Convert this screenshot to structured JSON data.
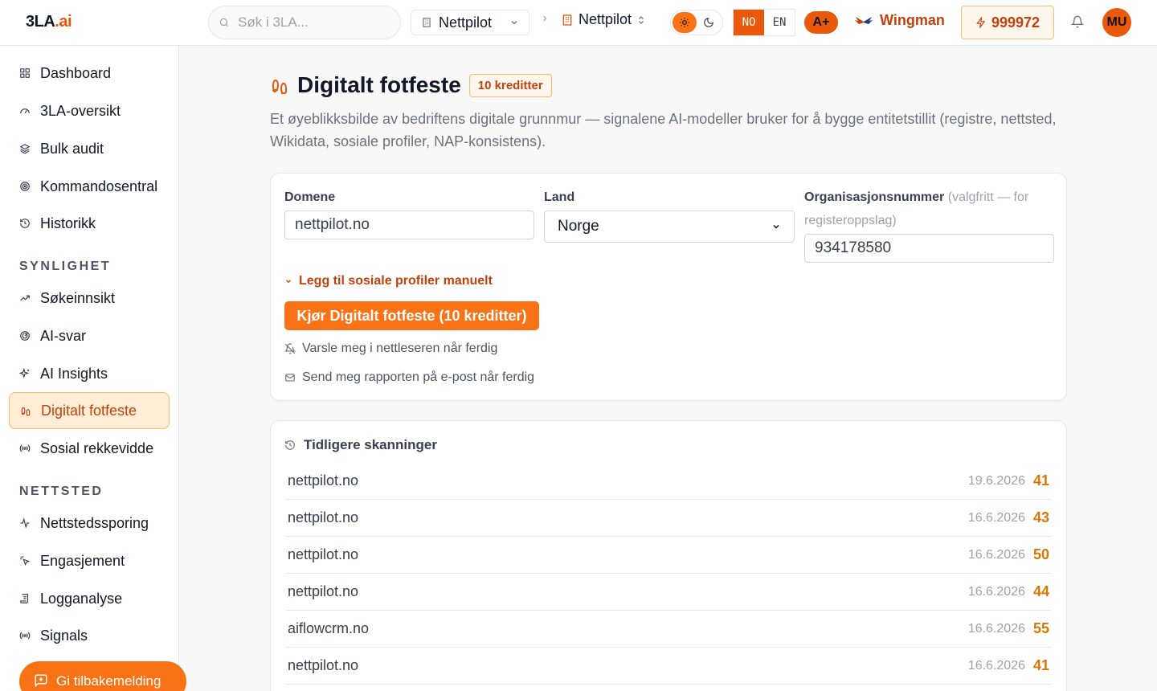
{
  "app": {
    "logo_main": "3LA",
    "logo_suffix": ".ai",
    "search_placeholder": "Søk i 3LA...",
    "workspace": "Nettpilot",
    "project": "Nettpilot",
    "lang_active": "NO",
    "lang_other": "EN",
    "grade": "A+",
    "wingman": "Wingman",
    "credits": "999972",
    "avatar_initials": "MU",
    "accent_color": "#f97316"
  },
  "sidebar": {
    "items_top": [
      {
        "label": "Dashboard",
        "icon": "grid-icon"
      },
      {
        "label": "3LA-oversikt",
        "icon": "gauge-icon"
      },
      {
        "label": "Bulk audit",
        "icon": "layers-icon"
      },
      {
        "label": "Kommandosentral",
        "icon": "target-icon"
      },
      {
        "label": "Historikk",
        "icon": "history-icon"
      }
    ],
    "section_synlighet": "SYNLIGHET",
    "items_synlighet": [
      {
        "label": "Søkeinnsikt",
        "icon": "trend-icon"
      },
      {
        "label": "AI-svar",
        "icon": "radar-icon"
      },
      {
        "label": "AI Insights",
        "icon": "sparkles-icon"
      },
      {
        "label": "Digitalt fotfeste",
        "icon": "footprints-icon",
        "active": true
      },
      {
        "label": "Sosial rekkevidde",
        "icon": "broadcast-icon"
      }
    ],
    "section_nettsted": "NETTSTED",
    "items_nettsted": [
      {
        "label": "Nettstedssporing",
        "icon": "activity-icon"
      },
      {
        "label": "Engasjement",
        "icon": "pointer-icon"
      },
      {
        "label": "Logganalyse",
        "icon": "scroll-icon"
      },
      {
        "label": "Signals",
        "icon": "broadcast-icon"
      }
    ],
    "feedback_label": "Gi tilbakemelding"
  },
  "main": {
    "title": "Digitalt fotfeste",
    "badge": "10 kreditter",
    "subtitle": "Et øyeblikksbilde av bedriftens digitale grunnmur — signalene AI-modeller bruker for å bygge entitetstillit (registre, nettsted, Wikidata, sosiale profiler, NAP-konsistens).",
    "form": {
      "domain_label": "Domene",
      "domain_value": "nettpilot.no",
      "country_label": "Land",
      "country_value": "Norge",
      "org_label": "Organisasjonsnummer",
      "org_hint": "(valgfritt — for registeroppslag)",
      "org_value": "934178580",
      "social_toggle": "Legg til sosiale profiler manuelt",
      "run_button": "Kjør Digitalt fotfeste (10 kreditter)",
      "notify_browser": "Varsle meg i nettleseren når ferdig",
      "notify_email": "Send meg rapporten på e-post når ferdig"
    },
    "history": {
      "title": "Tidligere skanninger",
      "rows": [
        {
          "domain": "nettpilot.no",
          "date": "19.6.2026",
          "score": "41"
        },
        {
          "domain": "nettpilot.no",
          "date": "16.6.2026",
          "score": "43"
        },
        {
          "domain": "nettpilot.no",
          "date": "16.6.2026",
          "score": "50"
        },
        {
          "domain": "nettpilot.no",
          "date": "16.6.2026",
          "score": "44"
        },
        {
          "domain": "aiflowcrm.no",
          "date": "16.6.2026",
          "score": "55"
        },
        {
          "domain": "nettpilot.no",
          "date": "16.6.2026",
          "score": "41"
        }
      ]
    }
  }
}
